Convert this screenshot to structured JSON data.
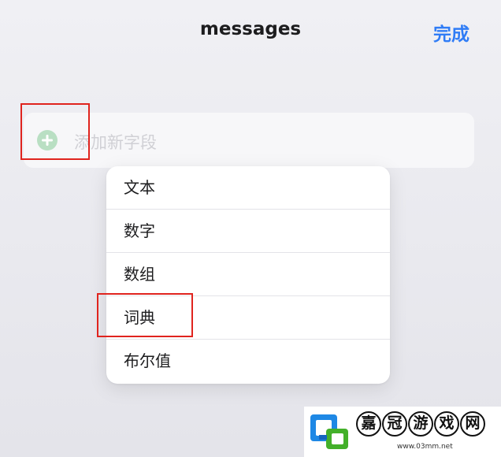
{
  "nav": {
    "title": "messages",
    "done_label": "完成"
  },
  "field": {
    "placeholder": "添加新字段",
    "add_icon": "plus-circle-icon"
  },
  "type_menu": {
    "items": [
      "文本",
      "数字",
      "数组",
      "词典",
      "布尔值"
    ]
  },
  "watermark": {
    "chars": [
      "嘉",
      "冠",
      "游",
      "戏",
      "网"
    ],
    "url": "www.03mm.net"
  },
  "colors": {
    "accent": "#2f7cf6",
    "highlight": "#e0241e",
    "add_icon": "#b9dfc3"
  }
}
